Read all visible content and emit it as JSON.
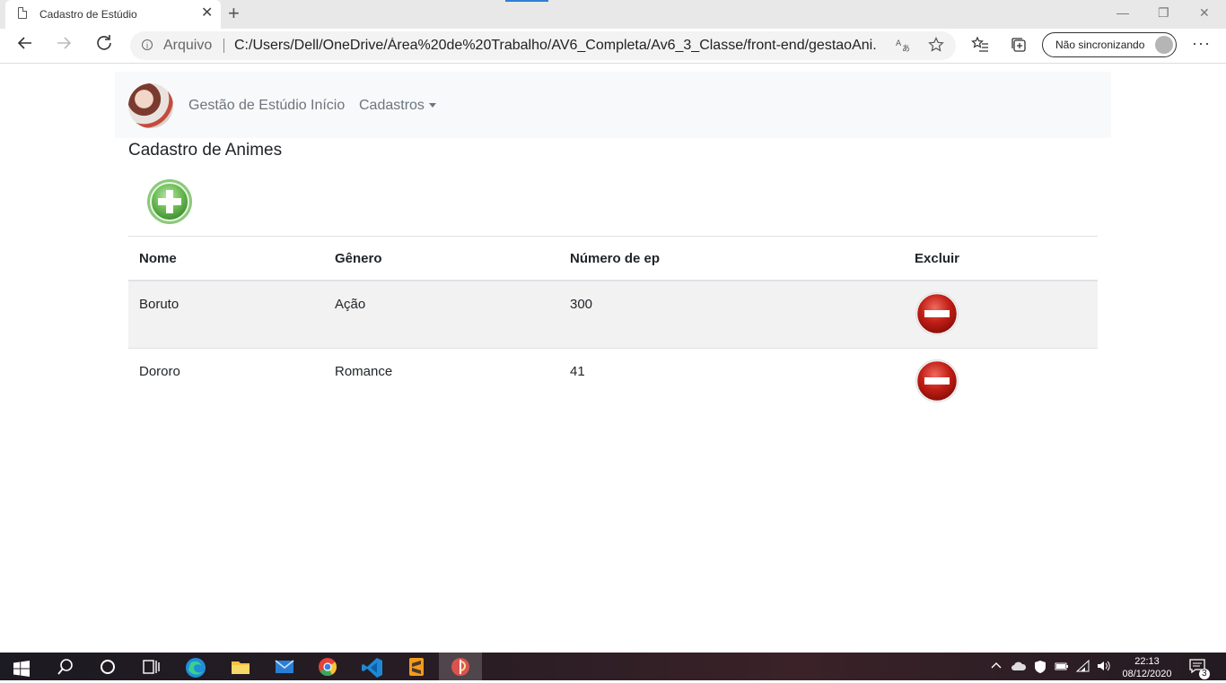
{
  "browser": {
    "tab_title": "Cadastro de Estúdio",
    "tab_close": "✕",
    "new_tab": "+",
    "address_prefix": "Arquivo",
    "url": "C:/Users/Dell/OneDrive/Área%20de%20Trabalho/AV6_Completa/Av6_3_Classe/front-end/gestaoAni...",
    "sync_label": "Não sincronizando",
    "window_controls": {
      "minimize": "—",
      "restore": "❐",
      "close": "✕"
    }
  },
  "navbar": {
    "brand": "Gestão de Estúdio",
    "links": [
      "Início",
      "Cadastros"
    ]
  },
  "page": {
    "title": "Cadastro de Animes"
  },
  "table": {
    "headers": [
      "Nome",
      "Gênero",
      "Número de ep",
      "Excluir"
    ],
    "rows": [
      {
        "nome": "Boruto",
        "genero": "Ação",
        "episodios": "300"
      },
      {
        "nome": "Dororo",
        "genero": "Romance",
        "episodios": "41"
      }
    ]
  },
  "taskbar": {
    "time": "22:13",
    "date": "08/12/2020",
    "notification_count": "3"
  },
  "colors": {
    "add_button": "#5cb85c",
    "delete_button": "#c9302c",
    "navbar_bg": "#f8f9fa",
    "stripe": "#f2f2f2"
  },
  "icons": [
    "document-icon",
    "back-icon",
    "forward-icon",
    "refresh-icon",
    "info-icon",
    "read-aloud-icon",
    "star-icon",
    "favorites-icon",
    "collections-icon",
    "profile-icon",
    "add-icon",
    "delete-icon",
    "windows-icon",
    "search-icon",
    "cortana-icon",
    "task-view-icon",
    "edge-icon",
    "explorer-icon",
    "mail-icon",
    "chrome-icon",
    "vscode-icon",
    "sublime-icon",
    "app-icon",
    "chevron-up-icon",
    "onedrive-icon",
    "defender-icon",
    "battery-icon",
    "wifi-icon",
    "volume-icon",
    "notifications-icon"
  ]
}
